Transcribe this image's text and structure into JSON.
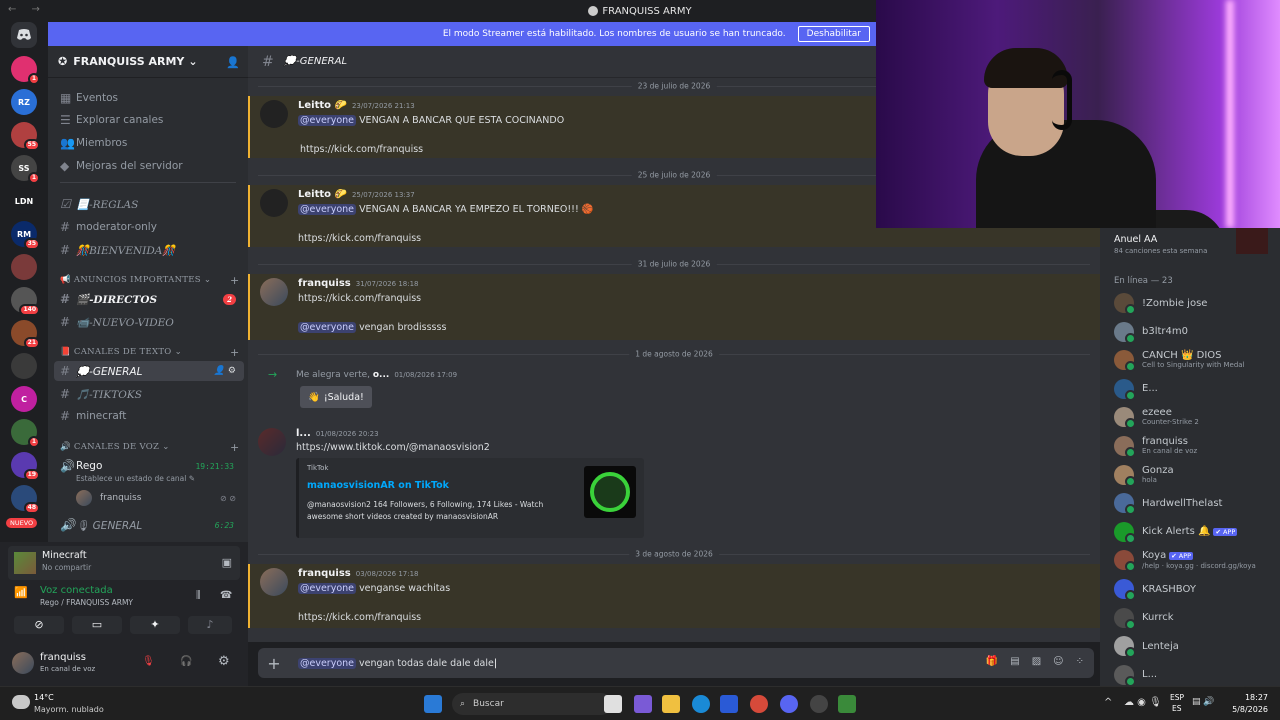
{
  "window": {
    "title": "FRANQUISS ARMY"
  },
  "streamer_banner": {
    "text": "El modo Streamer está habilitado. Los nombres de usuario se han truncado.",
    "button": "Deshabilitar"
  },
  "guild_rail": {
    "items": [
      {
        "label": "",
        "badge": "1",
        "color": "#e03070"
      },
      {
        "label": "RZ",
        "badge": "",
        "color": "#2a6fd6"
      },
      {
        "label": "",
        "badge": "55",
        "color": "#b04040"
      },
      {
        "label": "SS",
        "badge": "1",
        "color": "#444"
      },
      {
        "label": "LDN",
        "badge": "",
        "color": "#1e1f22"
      },
      {
        "label": "RM",
        "badge": "35",
        "color": "#0a2a6a"
      },
      {
        "label": "",
        "badge": "",
        "color": "#7a3a3a"
      },
      {
        "label": "",
        "badge": "140",
        "color": "#555"
      },
      {
        "label": "",
        "badge": "21",
        "color": "#8a4a2a"
      },
      {
        "label": "",
        "badge": "",
        "color": "#3a3a3a"
      },
      {
        "label": "C",
        "badge": "",
        "color": "#c020a0"
      },
      {
        "label": "",
        "badge": "1",
        "color": "#3a6a3a"
      },
      {
        "label": "",
        "badge": "19",
        "color": "#5a3ab0"
      },
      {
        "label": "",
        "badge": "48",
        "color": "#2a4a7a"
      }
    ],
    "new_label": "NUEVO"
  },
  "server": {
    "name": "FRANQUISS ARMY"
  },
  "sidebar": {
    "top": [
      "Eventos",
      "Explorar canales",
      "Miembros",
      "Mejoras del servidor"
    ],
    "channels": [
      "📃-REGLAS",
      "moderator-only",
      "🎊BIENVENIDA🎊"
    ],
    "cat1": "ANUNCIOS IMPORTANTES",
    "cat1_channels": [
      "🎬-DIRECTOS",
      "📹-NUEVO-VIDEO"
    ],
    "cat1_badge": "2",
    "cat2": "CANALES DE TEXTO",
    "cat2_channels": [
      "💭-GENERAL",
      "🎵-TIKTOKS",
      "minecraft"
    ],
    "cat3": "CANALES DE VOZ",
    "voice1": "Rego",
    "voice1_time": "19:21:33",
    "voice1_status": "Establece un estado de canal",
    "voice1_user": "franquiss",
    "voice2": "🎙 GENERAL",
    "voice2_time": "6:23"
  },
  "activity": {
    "title": "Minecraft",
    "sub": "No compartir"
  },
  "voice_panel": {
    "status": "Voz conectada",
    "sub": "Rego / FRANQUISS ARMY"
  },
  "user_panel": {
    "name": "franquiss",
    "status": "En canal de voz"
  },
  "channel_header": "💭-GENERAL",
  "messages": {
    "d1": "23 de julio de 2026",
    "m1": {
      "author": "Leitto 🌮",
      "time": "23/07/2026 21:13",
      "ping": "@everyone",
      "text": "VENGAN A BANCAR QUE ESTA COCINANDO",
      "link": "https://kick.com/franquiss"
    },
    "d2": "25 de julio de 2026",
    "m2": {
      "author": "Leitto 🌮",
      "time": "25/07/2026 13:37",
      "ping": "@everyone",
      "text": "VENGAN A BANCAR YA EMPEZO EL TORNEO!!! 🏀",
      "link": "https://kick.com/franquiss"
    },
    "d3": "31 de julio de 2026",
    "m3": {
      "author": "franquiss",
      "time": "31/07/2026 18:18",
      "link": "https://kick.com/franquiss",
      "ping": "@everyone",
      "text": "vengan brodisssss"
    },
    "d4": "1 de agosto de 2026",
    "m4": {
      "text": "Me alegra verte, ",
      "name": "o...",
      "time": "01/08/2026 17:09",
      "button": "¡Saluda!"
    },
    "m5": {
      "author": "l...",
      "time": "01/08/2026 20:23",
      "link": "https://www.tiktok.com/@manaosvision2",
      "provider": "TikTok",
      "embed_title": "manaosvisionAR on TikTok",
      "embed_desc1": "@manaosvision2 164 Followers, 6 Following, 174 Likes - Watch",
      "embed_desc2": "awesome short videos created by manaosvisionAR"
    },
    "d5": "3 de agosto de 2026",
    "m6": {
      "author": "franquiss",
      "time": "03/08/2026 17:18",
      "ping": "@everyone",
      "text": "venganse wachitas",
      "link": "https://kick.com/franquiss"
    }
  },
  "composer": {
    "ping": "@everyone",
    "text": "vengan todas dale dale dale"
  },
  "now_playing": {
    "artist": "Anuel AA",
    "sub": "84 canciones esta semana"
  },
  "members": {
    "heading": "En línea — 23",
    "list": [
      {
        "name": "!Zombie jose",
        "sub": "",
        "tag": ""
      },
      {
        "name": "b3ltr4m0",
        "sub": "",
        "tag": ""
      },
      {
        "name": "CANCH 👑 DIOS",
        "sub": "Cell to Singularity with Medal",
        "tag": ""
      },
      {
        "name": "E...",
        "sub": "",
        "tag": ""
      },
      {
        "name": "ezeee",
        "sub": "Counter-Strike 2",
        "tag": ""
      },
      {
        "name": "franquiss",
        "sub": "En canal de voz",
        "tag": ""
      },
      {
        "name": "Gonza",
        "sub": "hola",
        "tag": ""
      },
      {
        "name": "HardwellThelast",
        "sub": "",
        "tag": ""
      },
      {
        "name": "Kick Alerts 🔔",
        "sub": "",
        "tag": "✔ APP"
      },
      {
        "name": "Koya",
        "sub": "/help · koya.gg · discord.gg/koya",
        "tag": "✔ APP"
      },
      {
        "name": "KRASHBOY",
        "sub": "",
        "tag": ""
      },
      {
        "name": "Kurrck",
        "sub": "",
        "tag": ""
      },
      {
        "name": "Lenteja",
        "sub": "",
        "tag": ""
      },
      {
        "name": "L...",
        "sub": "",
        "tag": ""
      }
    ]
  },
  "taskbar": {
    "temp": "14°C",
    "weather": "Mayorm. nublado",
    "search": "Buscar",
    "lang1": "ESP",
    "lang2": "ES",
    "time": "18:27",
    "date": "5/8/2026"
  }
}
